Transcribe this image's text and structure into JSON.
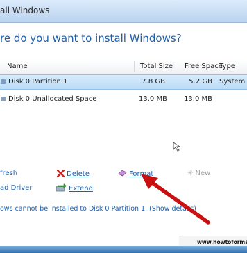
{
  "window": {
    "title": "all Windows"
  },
  "heading": "re do you want to install Windows?",
  "columns": {
    "name": "Name",
    "total_size": "Total Size",
    "free_space": "Free Space",
    "type": "Type"
  },
  "partitions": [
    {
      "name": "Disk 0 Partition 1",
      "total_size": "7.8 GB",
      "free_space": "5.2 GB",
      "type": "System",
      "selected": true
    },
    {
      "name": "Disk 0 Unallocated Space",
      "total_size": "13.0 MB",
      "free_space": "13.0 MB",
      "type": "",
      "selected": false
    }
  ],
  "actions": {
    "refresh": "fresh",
    "delete": "Delete",
    "format": "Format",
    "new": "New",
    "load_driver": "ad Driver",
    "extend": "Extend"
  },
  "warning": "ows cannot be installed to Disk 0 Partition 1.  (Show details)",
  "watermark": "www.howtoformatac",
  "colors": {
    "accent": "#1f5fa8",
    "arrow": "#e21b1b",
    "delete_x": "#d0201b"
  }
}
